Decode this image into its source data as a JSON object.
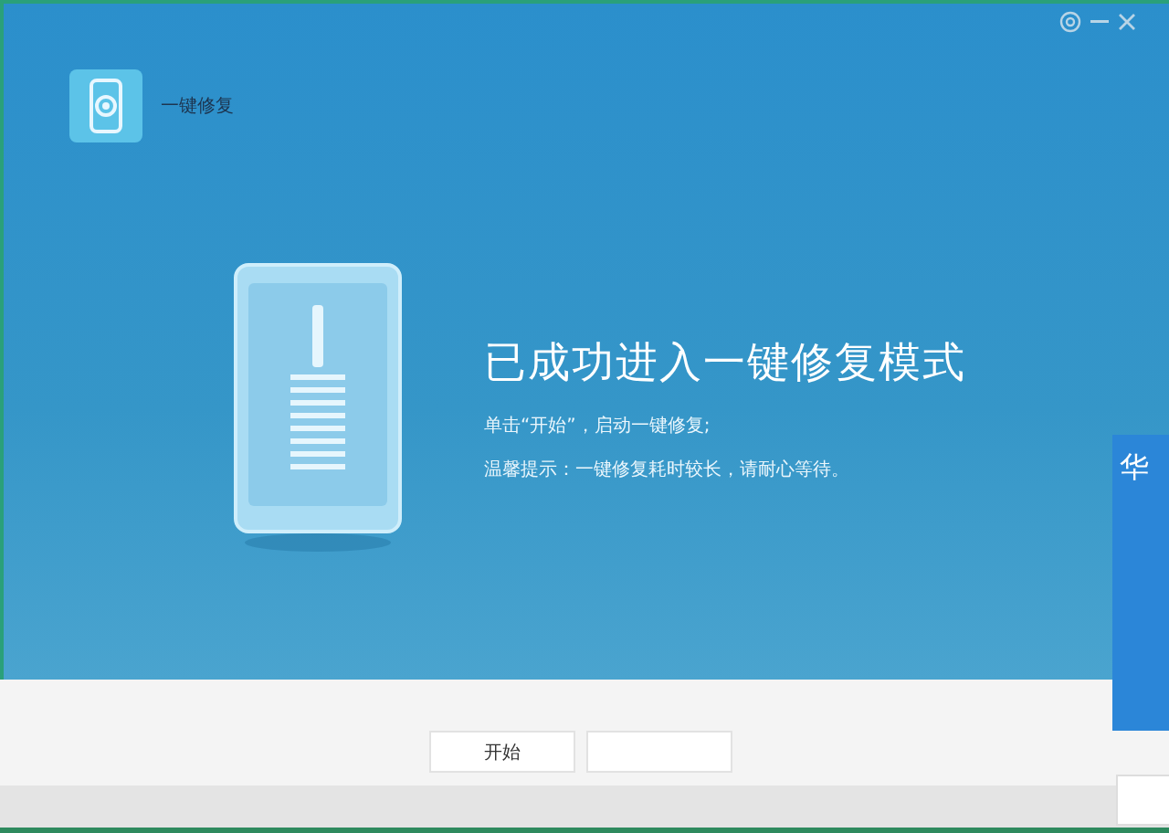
{
  "app": {
    "title": "一键修复"
  },
  "main": {
    "heading": "已成功进入一键修复模式",
    "lines": [
      "单击“开始”，启动一键修复;",
      "温馨提示：一键修复耗时较长，请耐心等待。"
    ]
  },
  "start_button": {
    "label": "开始"
  },
  "side_window": {
    "title": "华"
  }
}
